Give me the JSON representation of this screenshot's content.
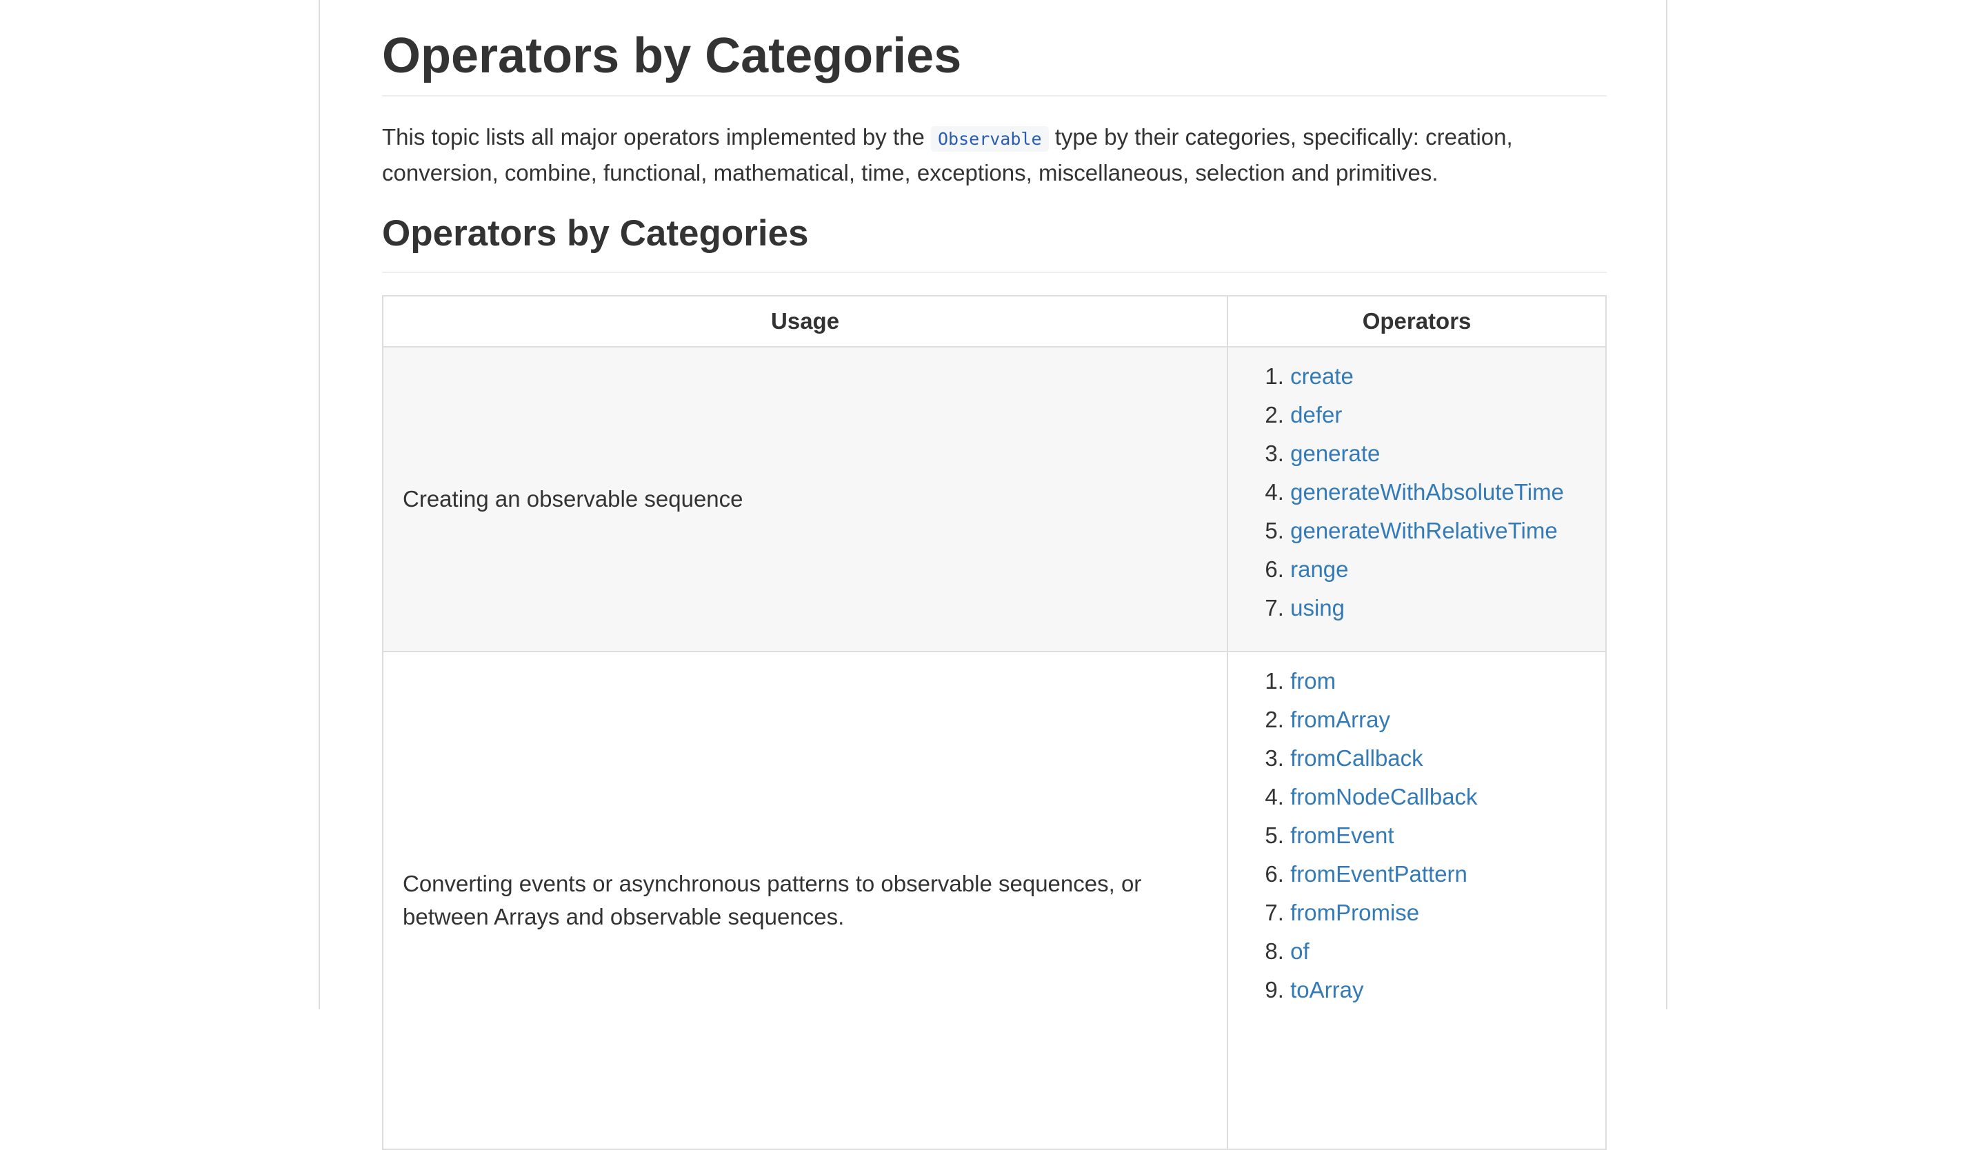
{
  "title": "Operators by Categories",
  "intro": {
    "before": "This topic lists all major operators implemented by the",
    "code": "Observable",
    "after": "type by their categories, specifically: creation, conversion, combine, functional, mathematical, time, exceptions, miscellaneous, selection and primitives."
  },
  "section_title": "Operators by Categories",
  "table": {
    "headers": [
      "Usage",
      "Operators"
    ],
    "rows": [
      {
        "usage": "Creating an observable sequence",
        "operators": [
          "create",
          "defer",
          "generate",
          "generateWithAbsoluteTime",
          "generateWithRelativeTime",
          "range",
          "using"
        ]
      },
      {
        "usage": "Converting events or asynchronous patterns to observable sequences, or between Arrays and observable sequences.",
        "operators": [
          "from",
          "fromArray",
          "fromCallback",
          "fromNodeCallback",
          "fromEvent",
          "fromEventPattern",
          "fromPromise",
          "of",
          "toArray"
        ]
      }
    ]
  },
  "colors": {
    "link": "#337ab7",
    "text": "#333333",
    "border": "#dddddd",
    "row_alt": "#f7f7f7",
    "code": "#2a5db0"
  }
}
